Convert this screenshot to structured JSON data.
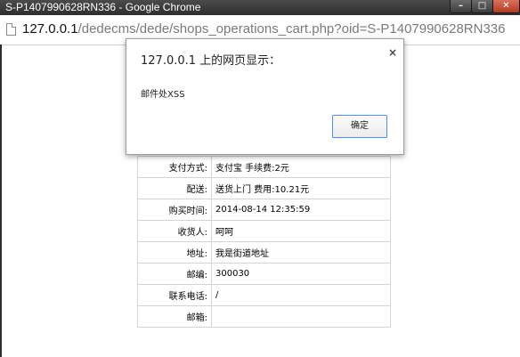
{
  "window": {
    "title": "S-P1407990628RN336 - Google Chrome",
    "minimize_glyph": "–",
    "maximize_glyph": "□",
    "close_glyph": "✕"
  },
  "address_bar": {
    "host": "127.0.0.1",
    "path": "/dedecms/dede/shops_operations_cart.php?oid=S-P1407990628RN336",
    "icon": "page-icon"
  },
  "order_info": {
    "rows": [
      {
        "label": "支付方式:",
        "value": "支付宝 手续费:2元"
      },
      {
        "label": "配送:",
        "value": "送货上门 费用:10.21元"
      },
      {
        "label": "购买时间:",
        "value": "2014-08-14 12:35:59"
      },
      {
        "label": "收货人:",
        "value": "呵呵"
      },
      {
        "label": "地址:",
        "value": "我是街道地址"
      },
      {
        "label": "邮编:",
        "value": "300030"
      },
      {
        "label": "联系电话:",
        "value": "/"
      },
      {
        "label": "邮箱:",
        "value": ""
      }
    ]
  },
  "dialog": {
    "heading": "127.0.0.1 上的网页显示：",
    "close_glyph": "×",
    "message": "邮件处XSS",
    "ok_label": "确定",
    "accent_color": "#4d90fe"
  }
}
